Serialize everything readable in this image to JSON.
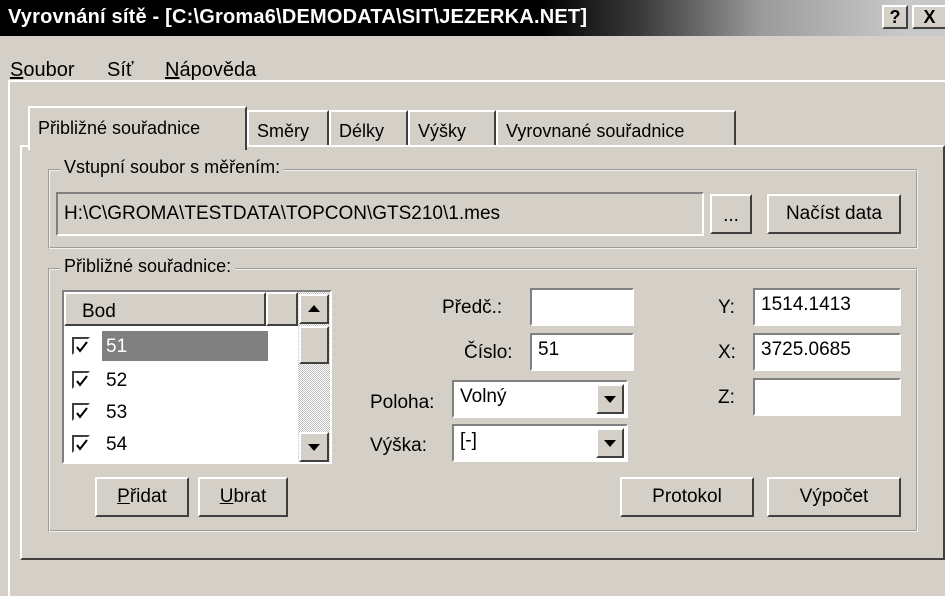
{
  "window": {
    "title": "Vyrovnání sítě - [C:\\Groma6\\DEMODATA\\SIT\\JEZERKA.NET]",
    "help_button": "?",
    "close_button": "X"
  },
  "menu": [
    {
      "label": "Soubor"
    },
    {
      "label": "Síť"
    },
    {
      "label": "Nápověda"
    }
  ],
  "tabs": [
    {
      "label": "Přibližné souřadnice",
      "active": true
    },
    {
      "label": "Směry"
    },
    {
      "label": "Délky"
    },
    {
      "label": "Výšky"
    },
    {
      "label": "Vyrovnané souřadnice"
    }
  ],
  "input_group": {
    "label": "Vstupní soubor s měřením:",
    "file_path": "H:\\C\\GROMA\\TESTDATA\\TOPCON\\GTS210\\1.mes",
    "browse_button": "...",
    "load_button": "Načíst data"
  },
  "approx_group": {
    "label": "Přibližné souřadnice:",
    "list_header": "Bod",
    "points": [
      {
        "id": "51",
        "checked": true,
        "selected": true
      },
      {
        "id": "52",
        "checked": true
      },
      {
        "id": "53",
        "checked": true
      },
      {
        "id": "54",
        "checked": true
      }
    ],
    "fields": {
      "predc_label": "Předč.:",
      "predc_value": "",
      "cislo_label": "Číslo:",
      "cislo_value": "51",
      "poloha_label": "Poloha:",
      "poloha_value": "Volný",
      "vyska_label": "Výška:",
      "vyska_value": "[-]",
      "y_label": "Y:",
      "y_value": "1514.1413",
      "x_label": "X:",
      "x_value": "3725.0685",
      "z_label": "Z:",
      "z_value": ""
    },
    "buttons": {
      "add": "Přidat",
      "remove": "Ubrat",
      "protocol": "Protokol",
      "compute": "Výpočet"
    }
  }
}
